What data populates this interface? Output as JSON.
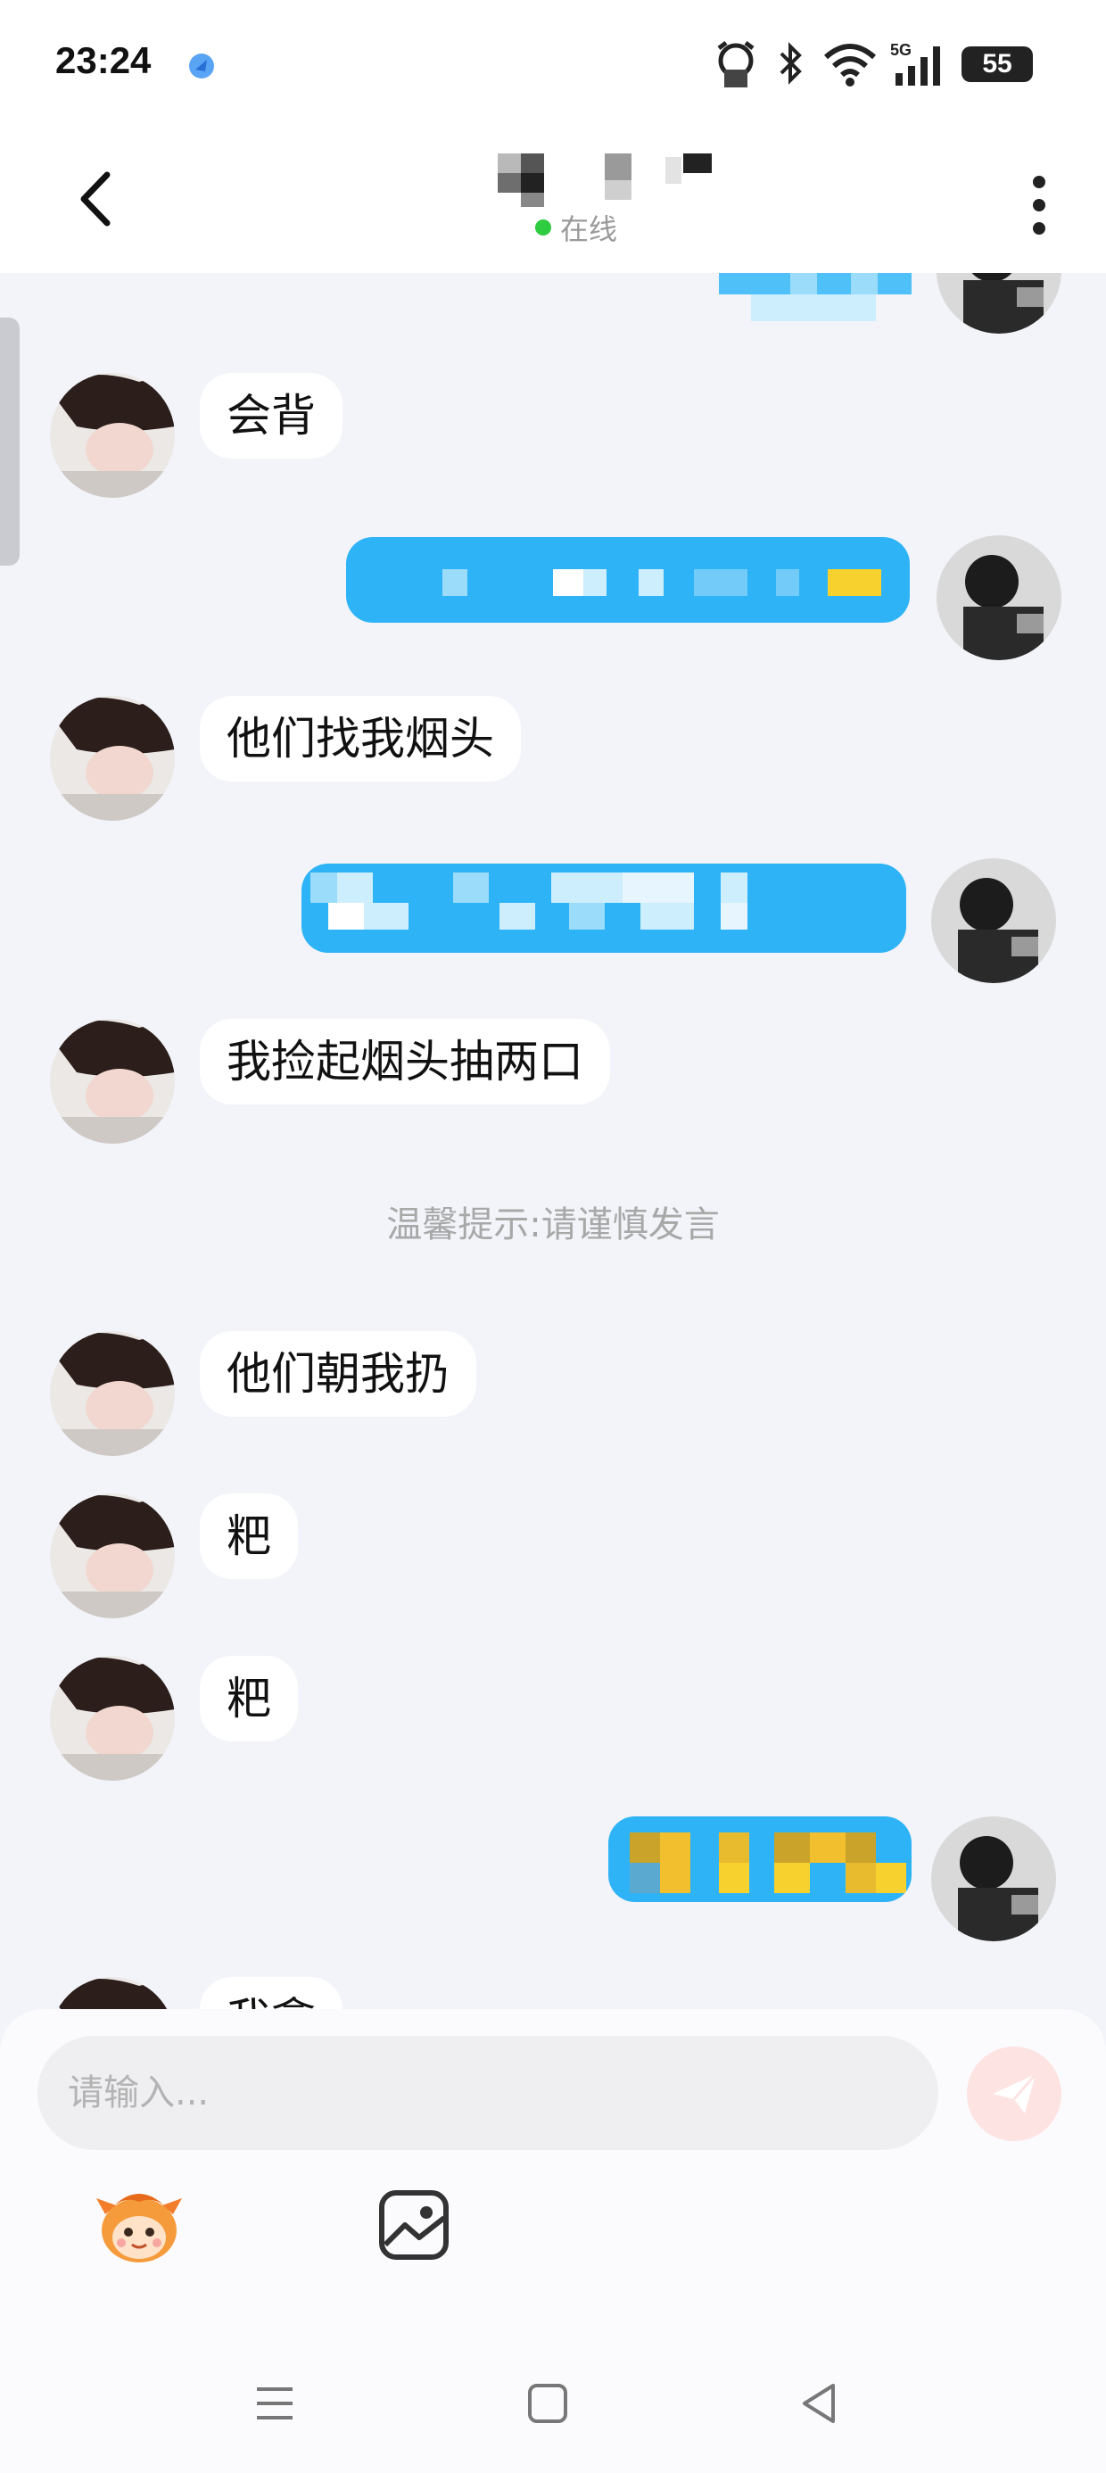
{
  "status_bar": {
    "time": "23:24",
    "battery": "55",
    "network": "5G",
    "icons": [
      "app-notification-icon",
      "alarm-icon",
      "bluetooth-icon",
      "wifi-icon",
      "signal-5g-icon",
      "battery-icon"
    ]
  },
  "header": {
    "presence": "在线",
    "presence_color": "#2ecc40",
    "back_icon": "back-chevron-icon",
    "more_icon": "more-vertical-icon"
  },
  "messages": {
    "incoming": [
      {
        "text": "会背"
      },
      {
        "text": "他们找我烟头"
      },
      {
        "text": "我捡起烟头抽两口"
      },
      {
        "text": "他们朝我扔"
      },
      {
        "text": "粑"
      },
      {
        "text": "粑"
      },
      {
        "text": "我拿"
      }
    ],
    "notice": "温馨提示:请谨慎发言"
  },
  "input": {
    "placeholder": "请输入...",
    "send_icon": "send-plane-icon",
    "emoji_icon": "mascot-emoji-icon",
    "image_icon": "image-icon"
  },
  "nav": {
    "icons": [
      "menu-icon",
      "home-square-icon",
      "back-triangle-icon"
    ]
  },
  "colors": {
    "outgoing_bubble": "#2fb3f7",
    "incoming_bubble": "#ffffff",
    "background": "#f2f4f9",
    "send_button": "#fde3e1"
  }
}
